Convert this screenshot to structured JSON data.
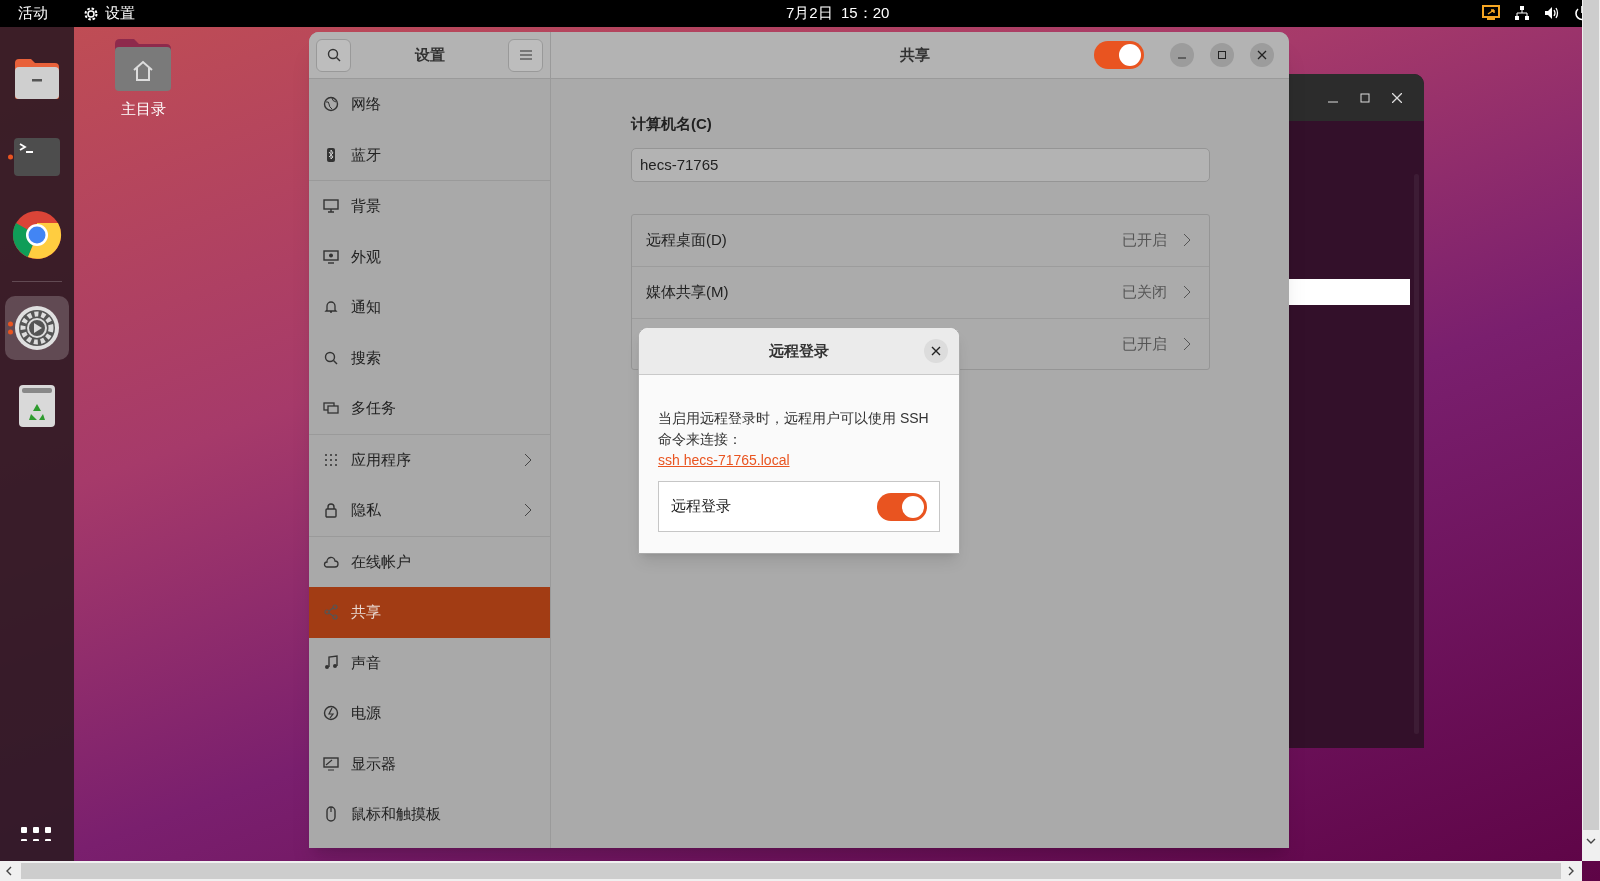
{
  "top_bar": {
    "activities": "活动",
    "app_menu": "设置",
    "clock": "7月2日  15：20"
  },
  "dock": {
    "items": [
      {
        "kind": "files",
        "running": false,
        "focused": false
      },
      {
        "kind": "terminal",
        "running": true,
        "focused": false
      },
      {
        "kind": "browser",
        "running": false,
        "focused": false
      },
      {
        "kind": "settings",
        "running": true,
        "focused": true
      },
      {
        "kind": "trash",
        "running": false,
        "focused": false
      }
    ]
  },
  "desktop": {
    "icons": [
      {
        "label": "主目录"
      }
    ]
  },
  "settings": {
    "sidebar_title": "设置",
    "page_title": "共享",
    "sharing_on": true,
    "sidebar_groups": [
      [
        {
          "label": "网络",
          "arrow": false,
          "selected": false
        },
        {
          "label": "蓝牙",
          "arrow": false,
          "selected": false
        }
      ],
      [
        {
          "label": "背景",
          "arrow": false,
          "selected": false
        },
        {
          "label": "外观",
          "arrow": false,
          "selected": false
        },
        {
          "label": "通知",
          "arrow": false,
          "selected": false
        },
        {
          "label": "搜索",
          "arrow": false,
          "selected": false
        },
        {
          "label": "多任务",
          "arrow": false,
          "selected": false
        }
      ],
      [
        {
          "label": "应用程序",
          "arrow": true,
          "selected": false
        },
        {
          "label": "隐私",
          "arrow": true,
          "selected": false
        }
      ],
      [
        {
          "label": "在线帐户",
          "arrow": false,
          "selected": false
        },
        {
          "label": "共享",
          "arrow": false,
          "selected": true
        },
        {
          "label": "声音",
          "arrow": false,
          "selected": false
        },
        {
          "label": "电源",
          "arrow": false,
          "selected": false
        },
        {
          "label": "显示器",
          "arrow": false,
          "selected": false
        },
        {
          "label": "鼠标和触摸板",
          "arrow": false,
          "selected": false
        }
      ]
    ],
    "hostname_label": "计算机名(C)",
    "hostname": "hecs-71765",
    "services": [
      {
        "name": "远程桌面(D)",
        "status": "已开启"
      },
      {
        "name": "媒体共享(M)",
        "status": "已关闭"
      },
      {
        "status": "已开启"
      }
    ]
  },
  "dialog": {
    "title": "远程登录",
    "description": "当启用远程登录时，远程用户可以使用 SSH 命令来连接：",
    "link": "ssh hecs-71765.local",
    "switch_label": "远程登录",
    "switch_on": true
  }
}
